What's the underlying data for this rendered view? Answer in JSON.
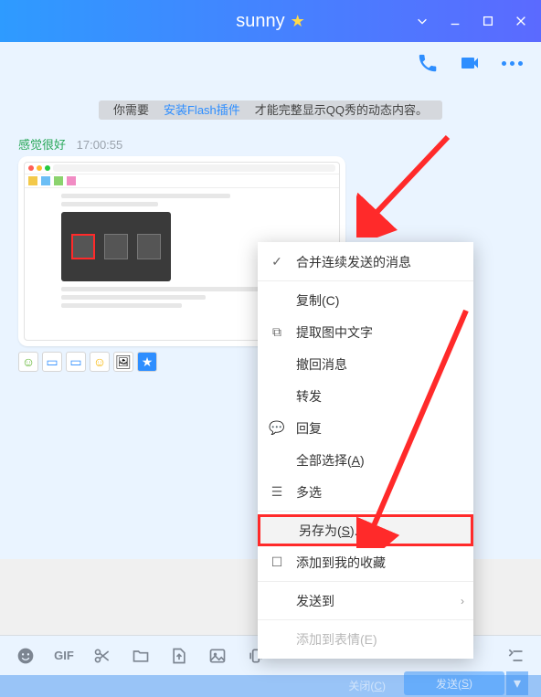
{
  "header": {
    "title": "sunny"
  },
  "flash": {
    "pre": "你需要",
    "link": "安装Flash插件",
    "post": "才能完整显示QQ秀的动态内容。"
  },
  "message": {
    "sender": "感觉很好",
    "time": "17:00:55"
  },
  "context_menu": {
    "merge": "合并连续发送的消息",
    "copy": "复制(C)",
    "ocr": "提取图中文字",
    "recall": "撤回消息",
    "forward": "转发",
    "reply": "回复",
    "select_all_pre": "全部选择(",
    "select_all_u": "A",
    "select_all_post": ")",
    "multi": "多选",
    "save_as_pre": "另存为(",
    "save_as_u": "S",
    "save_as_post": ")...",
    "favorite": "添加到我的收藏",
    "send_to": "发送到",
    "emoji": "添加到表情(E)"
  },
  "bottom": {
    "close_pre": "关闭(",
    "close_u": "C",
    "close_post": ")",
    "send_pre": "发送(",
    "send_u": "S",
    "send_post": ")"
  },
  "toolbar_gif": "GIF"
}
